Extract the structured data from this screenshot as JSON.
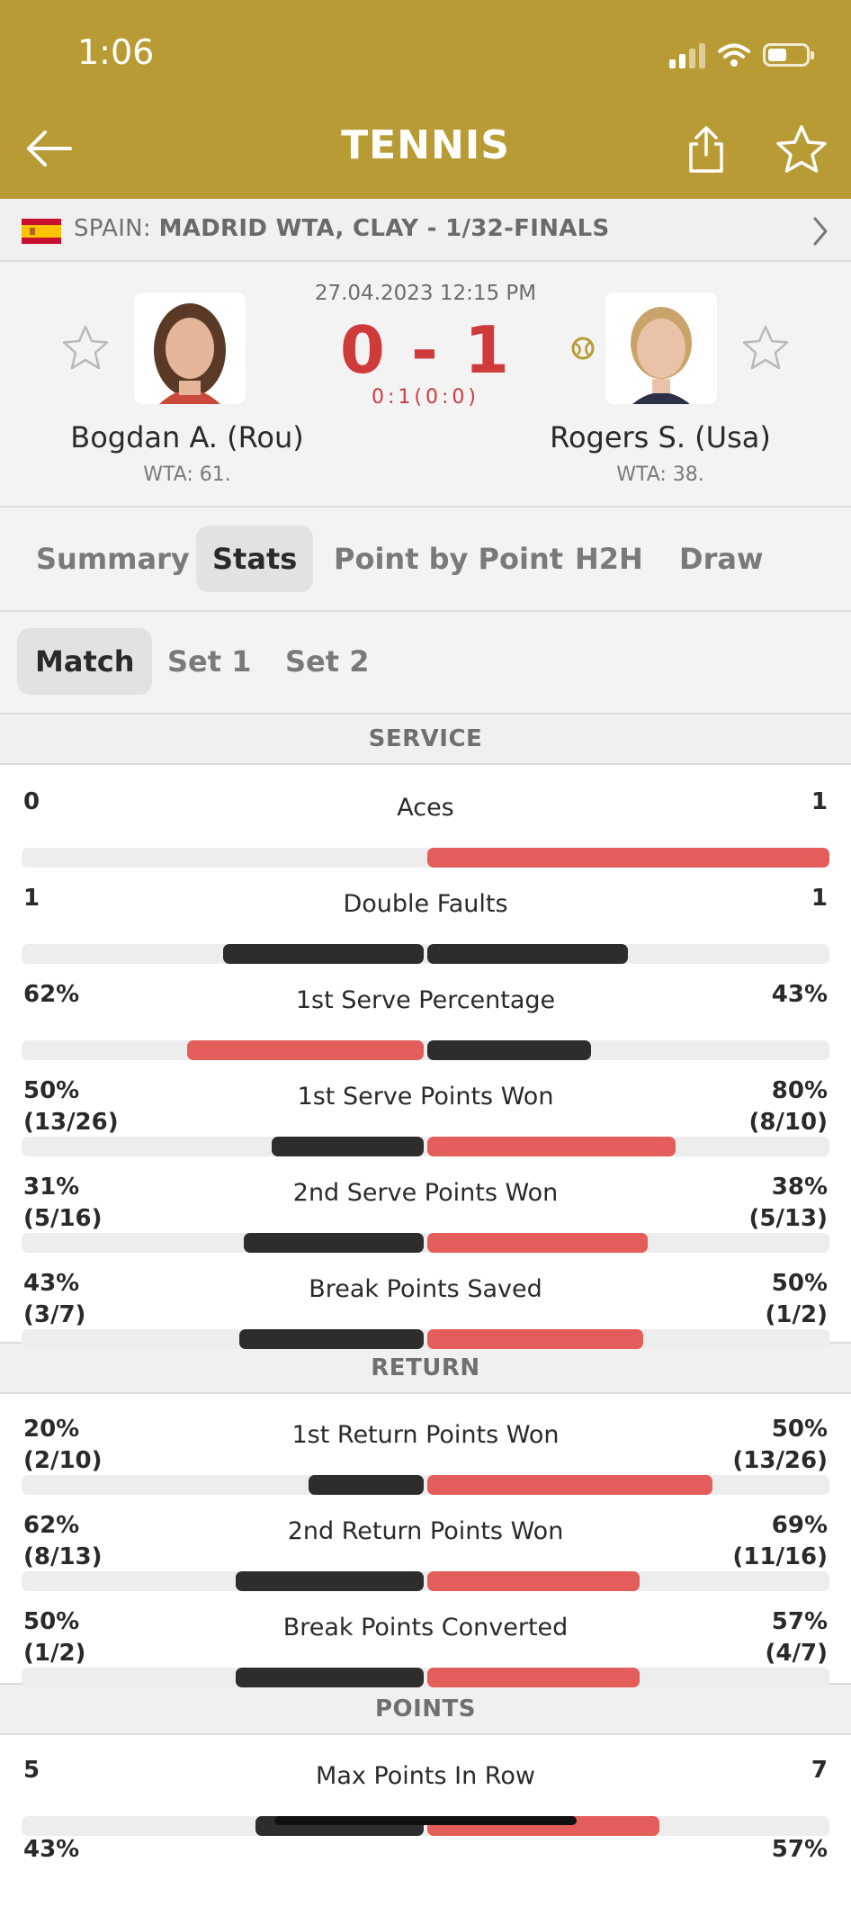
{
  "status_bar": {
    "time": "1:06"
  },
  "header": {
    "title": "TENNIS"
  },
  "league": {
    "country": "SPAIN:",
    "competition": "MADRID WTA, CLAY - 1/32-FINALS"
  },
  "match": {
    "datetime": "27.04.2023 12:15 PM",
    "score": "0 - 1",
    "set_scores": "0:1(0:0)",
    "home": {
      "name": "Bogdan A. (Rou)",
      "rank": "WTA: 61."
    },
    "away": {
      "name": "Rogers S. (Usa)",
      "rank": "WTA: 38."
    }
  },
  "tabs": [
    "Summary",
    "Stats",
    "Point by Point",
    "H2H",
    "Draw"
  ],
  "active_tab": "Stats",
  "period_tabs": [
    "Match",
    "Set 1",
    "Set 2"
  ],
  "active_period": "Match",
  "sections": [
    "SERVICE",
    "RETURN",
    "POINTS"
  ],
  "stats": [
    {
      "section": "SERVICE",
      "name": "Aces",
      "home": "0",
      "home_sub": "",
      "away": "1",
      "away_sub": "",
      "home_share": 0,
      "away_share": 1.0,
      "home_color": "dark",
      "away_color": "red"
    },
    {
      "section": "SERVICE",
      "name": "Double Faults",
      "home": "1",
      "home_sub": "",
      "away": "1",
      "away_sub": "",
      "home_share": 0.5,
      "away_share": 0.5,
      "home_color": "dark",
      "away_color": "dark"
    },
    {
      "section": "SERVICE",
      "name": "1st Serve Percentage",
      "home": "62%",
      "home_sub": "",
      "away": "43%",
      "away_sub": "",
      "home_share": 0.59,
      "away_share": 0.41,
      "home_color": "red",
      "away_color": "dark"
    },
    {
      "section": "SERVICE",
      "name": "1st Serve Points Won",
      "home": "50%",
      "home_sub": "(13/26)",
      "away": "80%",
      "away_sub": "(8/10)",
      "home_share": 0.38,
      "away_share": 0.62,
      "home_color": "dark",
      "away_color": "red"
    },
    {
      "section": "SERVICE",
      "name": "2nd Serve Points Won",
      "home": "31%",
      "home_sub": "(5/16)",
      "away": "38%",
      "away_sub": "(5/13)",
      "home_share": 0.45,
      "away_share": 0.55,
      "home_color": "dark",
      "away_color": "red"
    },
    {
      "section": "SERVICE",
      "name": "Break Points Saved",
      "home": "43%",
      "home_sub": "(3/7)",
      "away": "50%",
      "away_sub": "(1/2)",
      "home_share": 0.46,
      "away_share": 0.54,
      "home_color": "dark",
      "away_color": "red"
    },
    {
      "section": "RETURN",
      "name": "1st Return Points Won",
      "home": "20%",
      "home_sub": "(2/10)",
      "away": "50%",
      "away_sub": "(13/26)",
      "home_share": 0.29,
      "away_share": 0.71,
      "home_color": "dark",
      "away_color": "red"
    },
    {
      "section": "RETURN",
      "name": "2nd Return Points Won",
      "home": "62%",
      "home_sub": "(8/13)",
      "away": "69%",
      "away_sub": "(11/16)",
      "home_share": 0.47,
      "away_share": 0.53,
      "home_color": "dark",
      "away_color": "red"
    },
    {
      "section": "RETURN",
      "name": "Break Points Converted",
      "home": "50%",
      "home_sub": "(1/2)",
      "away": "57%",
      "away_sub": "(4/7)",
      "home_share": 0.47,
      "away_share": 0.53,
      "home_color": "dark",
      "away_color": "red"
    },
    {
      "section": "POINTS",
      "name": "Max Points In Row",
      "home": "5",
      "home_sub": "",
      "away": "7",
      "away_sub": "",
      "home_share": 0.42,
      "away_share": 0.58,
      "home_color": "dark",
      "away_color": "red"
    }
  ],
  "partial_row": {
    "home": "43%",
    "away": "57%"
  },
  "colors": {
    "header_gold": "#b99b35",
    "score_red": "#cf3b3b",
    "bar_red": "#e35d5b",
    "bar_dark": "#2d2d2d"
  }
}
